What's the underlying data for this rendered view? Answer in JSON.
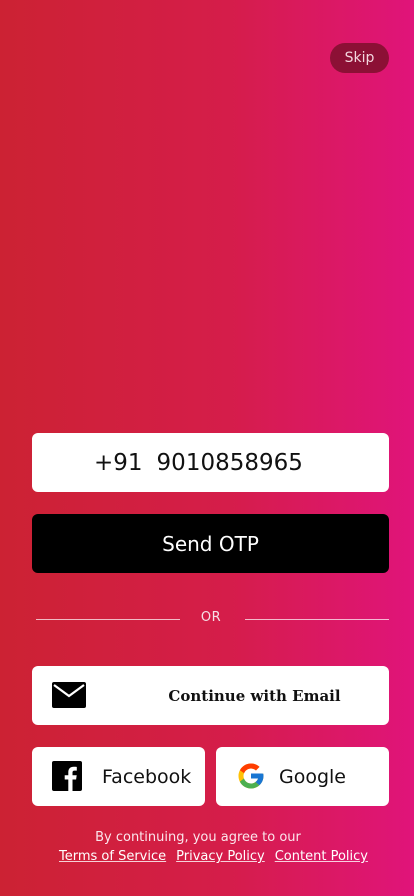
{
  "skip_label": "Skip",
  "phone": {
    "country_code": "+91",
    "number": "9010858965"
  },
  "send_otp_label": "Send OTP",
  "divider_text": "OR",
  "email_button_label": "Continue with Email",
  "facebook_label": "Facebook",
  "google_label": "Google",
  "footer": {
    "agree_text": "By continuing, you agree to our",
    "terms": "Terms of Service",
    "privacy": "Privacy Policy",
    "content": "Content Policy"
  },
  "colors": {
    "gradient_start": "#cc2233",
    "gradient_end": "#e0147a",
    "skip_bg": "#8c1035",
    "send_bg": "#000000",
    "facebook_blue": "#000000"
  },
  "icons": {
    "email": "mail-icon",
    "facebook": "facebook-icon",
    "google": "google-icon"
  }
}
